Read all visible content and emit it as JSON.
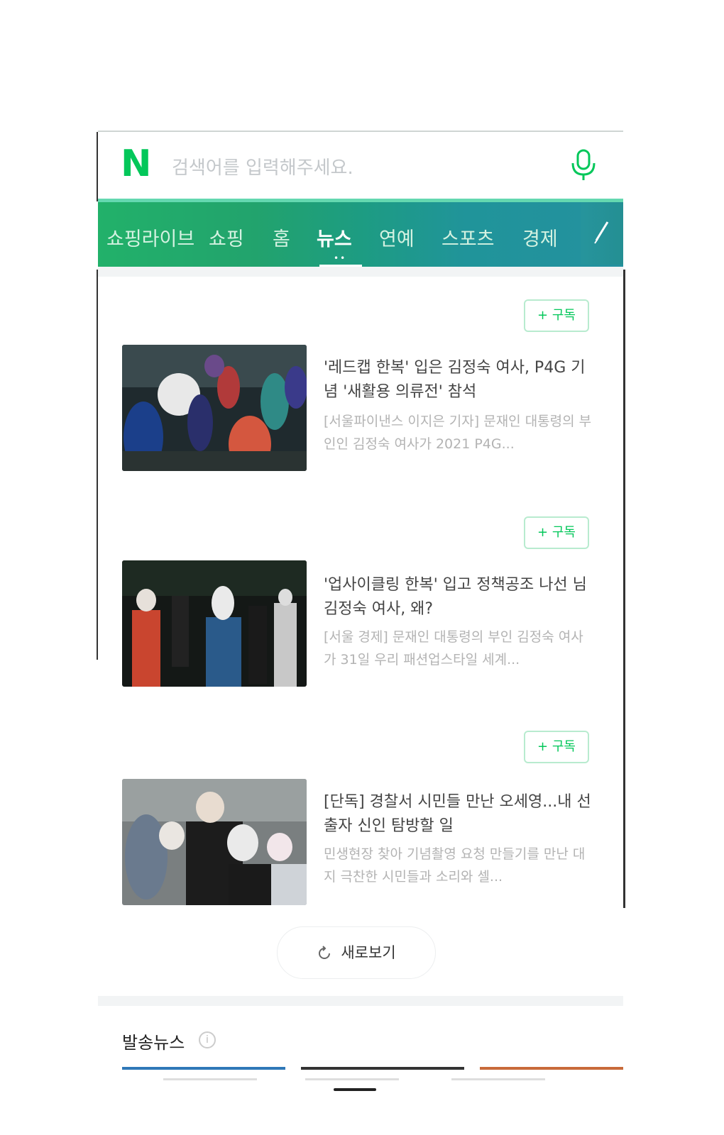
{
  "search": {
    "logo": "N",
    "placeholder": "검색어를 입력해주세요."
  },
  "nav": {
    "tabs": [
      {
        "label": "쇼핑라이브"
      },
      {
        "label": "쇼핑"
      },
      {
        "label": "홈"
      },
      {
        "label": "뉴스"
      },
      {
        "label": "연예"
      },
      {
        "label": "스포츠"
      },
      {
        "label": "경제"
      }
    ],
    "active": "뉴스"
  },
  "news": [
    {
      "subscribe": "+ 구독",
      "headline": "'레드캡 한복' 입은 김정숙 여사, P4G 기념 '새활용 의류전' 참석",
      "summary": "[서울파이낸스 이지은 기자] 문재인 대통령의 부인인 김정숙 여사가 2021 P4G..."
    },
    {
      "subscribe": "+ 구독",
      "headline": "'업사이클링 한복' 입고 정책공조 나선 님 김정숙 여사, 왜?",
      "summary": "[서울 경제] 문재인 대통령의 부인 김정숙 여사가 31일 우리 패션업스타일 세계..."
    },
    {
      "subscribe": "+ 구독",
      "headline": "[단독] 경찰서 시민들 만난 오세영...내 선출자 신인 탐방할 일",
      "summary": "민생현장 찾아 기념촬영 요청 만들기를 만난 대지 극찬한 시민들과 소리와 셀..."
    }
  ],
  "refresh_label": "새로보기",
  "section": {
    "title": "발송뉴스",
    "info": "i"
  }
}
